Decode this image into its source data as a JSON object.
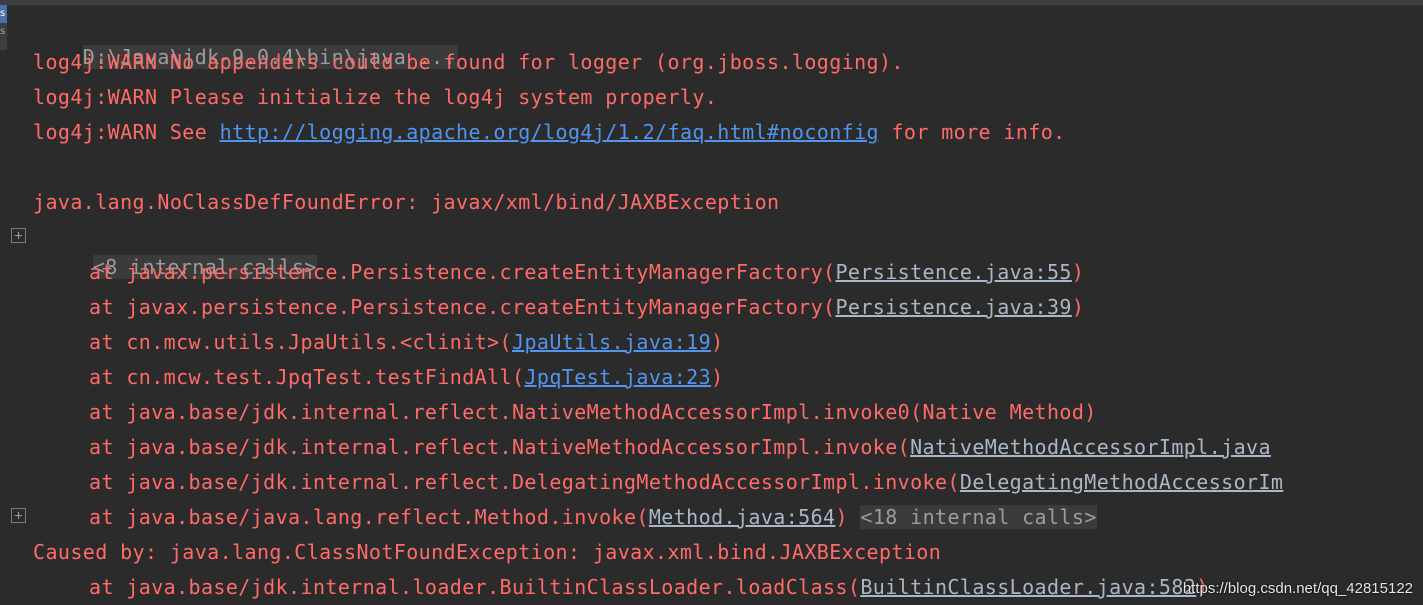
{
  "console": {
    "command_line": "D:\\Java\\jdk-9.0.4\\bin\\java ...",
    "warn1": "log4j:WARN No appenders could be found for logger (org.jboss.logging).",
    "warn2": "log4j:WARN Please initialize the log4j system properly.",
    "warn3_prefix": "log4j:WARN See ",
    "warn3_url": "http://logging.apache.org/log4j/1.2/faq.html#noconfig",
    "warn3_suffix": " for more info.",
    "error_line": "java.lang.NoClassDefFoundError: javax/xml/bind/JAXBException",
    "internal_calls_1": "<8 internal calls>",
    "trace": [
      {
        "prefix": "at javax.persistence.Persistence.createEntityManagerFactory(",
        "link": "Persistence.java:55",
        "suffix": ")"
      },
      {
        "prefix": "at javax.persistence.Persistence.createEntityManagerFactory(",
        "link": "Persistence.java:39",
        "suffix": ")"
      },
      {
        "prefix": "at cn.mcw.utils.JpaUtils.<clinit>(",
        "link": "JpaUtils.java:19",
        "suffix": ")"
      },
      {
        "prefix": "at cn.mcw.test.JpqTest.testFindAll(",
        "link": "JpqTest.java:23",
        "suffix": ")"
      },
      {
        "prefix": "at java.base/jdk.internal.reflect.NativeMethodAccessorImpl.invoke0(Native Method)",
        "link": "",
        "suffix": ""
      },
      {
        "prefix": "at java.base/jdk.internal.reflect.NativeMethodAccessorImpl.invoke(",
        "link": "NativeMethodAccessorImpl.java",
        "suffix": ""
      },
      {
        "prefix": "at java.base/jdk.internal.reflect.DelegatingMethodAccessorImpl.invoke(",
        "link": "DelegatingMethodAccessorIm",
        "suffix": ""
      },
      {
        "prefix": "at java.base/java.lang.reflect.Method.invoke(",
        "link": "Method.java:564",
        "suffix": ") "
      }
    ],
    "internal_calls_2": "<18 internal calls>",
    "caused_by": "Caused by: java.lang.ClassNotFoundException: javax.xml.bind.JAXBException",
    "last_trace": {
      "prefix": "at java.base/jdk.internal.loader.BuiltinClassLoader.loadClass(",
      "link": "BuiltinClassLoader.java:582",
      "suffix": ")"
    }
  },
  "watermark": "https://blog.csdn.net/qq_42815122",
  "colors": {
    "background": "#2b2b2b",
    "error_text": "#ff6b68",
    "url": "#5394ec",
    "file_link": "#a9b7c6",
    "fold_text": "#9c9c9c"
  },
  "icons": [
    "fold-expand-icon"
  ]
}
